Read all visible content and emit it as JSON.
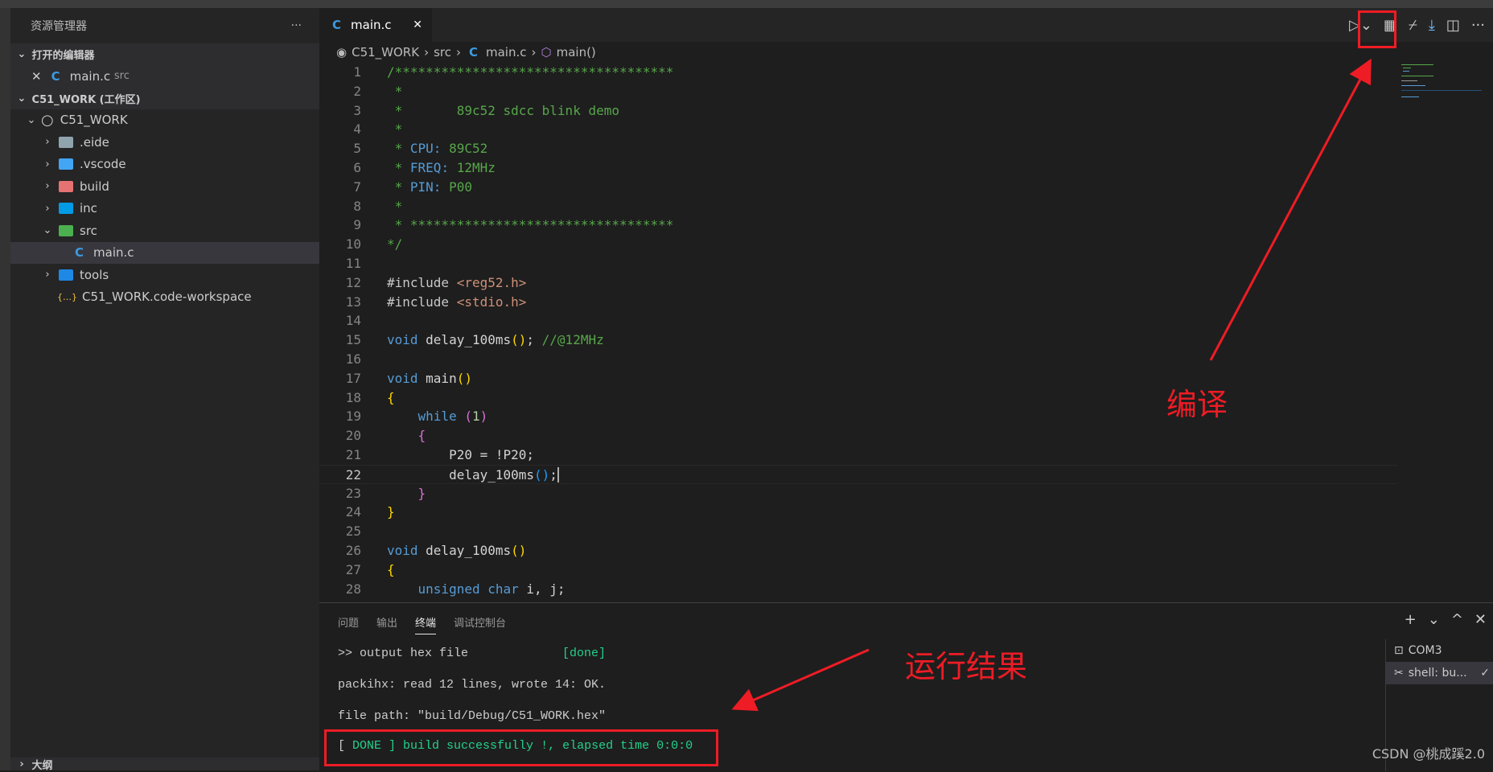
{
  "sidebar": {
    "title": "资源管理器",
    "more": "···",
    "open_editors": "打开的编辑器",
    "open_file": "main.c",
    "open_file_dir": "src",
    "workspace": "C51_WORK (工作区)",
    "tree": [
      {
        "label": "C51_WORK",
        "icon": "circle-icon",
        "chev": "⌄",
        "depth": 1
      },
      {
        "label": ".eide",
        "icon": "folder-icon",
        "color": "#90a4ae",
        "chev": "›",
        "depth": 2
      },
      {
        "label": ".vscode",
        "icon": "folder-vscode-icon",
        "color": "#42a5f5",
        "chev": "›",
        "depth": 2
      },
      {
        "label": "build",
        "icon": "folder-build-icon",
        "color": "#e57373",
        "chev": "›",
        "depth": 2
      },
      {
        "label": "inc",
        "icon": "folder-include-icon",
        "color": "#039be5",
        "chev": "›",
        "depth": 2
      },
      {
        "label": "src",
        "icon": "folder-src-icon",
        "color": "#4caf50",
        "chev": "⌄",
        "depth": 2
      },
      {
        "label": "main.c",
        "icon": "c-file-icon",
        "chev": "",
        "depth": 3,
        "selected": true
      },
      {
        "label": "tools",
        "icon": "folder-tools-icon",
        "color": "#1e88e5",
        "chev": "›",
        "depth": 2
      },
      {
        "label": "C51_WORK.code-workspace",
        "icon": "json-braces-icon",
        "chev": "",
        "depth": 2
      }
    ],
    "outline": "大纲"
  },
  "editor": {
    "tab": "main.c",
    "c_glyph": "C",
    "breadcrumb": [
      "C51_WORK",
      "src",
      "main.c",
      "main()"
    ],
    "current_line": 22,
    "lines": [
      [
        [
          "/************************************",
          "c"
        ]
      ],
      [
        [
          " *",
          "c"
        ]
      ],
      [
        [
          " *       89c52 sdcc blink demo",
          "c"
        ]
      ],
      [
        [
          " *",
          "c"
        ]
      ],
      [
        [
          " * ",
          "c"
        ],
        [
          "CPU:",
          "d"
        ],
        [
          " 89C52",
          "c"
        ]
      ],
      [
        [
          " * ",
          "c"
        ],
        [
          "FREQ:",
          "d"
        ],
        [
          " 12MHz",
          "c"
        ]
      ],
      [
        [
          " * ",
          "c"
        ],
        [
          "PIN:",
          "d"
        ],
        [
          " P00",
          "c"
        ]
      ],
      [
        [
          " *",
          "c"
        ]
      ],
      [
        [
          " * **********************************",
          "c"
        ]
      ],
      [
        [
          "*/",
          "c"
        ]
      ],
      [],
      [
        [
          "#include ",
          "p"
        ],
        [
          "<reg52.h>",
          "s"
        ]
      ],
      [
        [
          "#include ",
          "p"
        ],
        [
          "<stdio.h>",
          "s"
        ]
      ],
      [],
      [
        [
          "void",
          "k"
        ],
        [
          " delay_100ms",
          "t"
        ],
        [
          "()",
          "b1"
        ],
        [
          "; ",
          "t"
        ],
        [
          "//@12MHz",
          "c"
        ]
      ],
      [],
      [
        [
          "void",
          "k"
        ],
        [
          " main",
          "t"
        ],
        [
          "()",
          "b1"
        ]
      ],
      [
        [
          "{",
          "b1"
        ]
      ],
      [
        [
          "    ",
          "t"
        ],
        [
          "while",
          "k"
        ],
        [
          " ",
          "t"
        ],
        [
          "(",
          "b2"
        ],
        [
          "1",
          "n"
        ],
        [
          ")",
          "b2"
        ]
      ],
      [
        [
          "    ",
          "t"
        ],
        [
          "{",
          "b2"
        ]
      ],
      [
        [
          "        P20 = !P20;",
          "t"
        ]
      ],
      [
        [
          "        delay_100ms",
          "t"
        ],
        [
          "()",
          "b3"
        ],
        [
          ";",
          "t"
        ]
      ],
      [
        [
          "    ",
          "t"
        ],
        [
          "}",
          "b2"
        ]
      ],
      [
        [
          "}",
          "b1"
        ]
      ],
      [],
      [
        [
          "void",
          "k"
        ],
        [
          " delay_100ms",
          "t"
        ],
        [
          "()",
          "b1"
        ]
      ],
      [
        [
          "{",
          "b1"
        ]
      ],
      [
        [
          "    ",
          "t"
        ],
        [
          "unsigned",
          "k"
        ],
        [
          " ",
          "t"
        ],
        [
          "char",
          "k"
        ],
        [
          " i, j;",
          "t"
        ]
      ]
    ]
  },
  "panel": {
    "tabs": [
      "问题",
      "输出",
      "终端",
      "调试控制台"
    ],
    "active_tab": "终端",
    "terminal": [
      ">> output hex file             ",
      "[done]",
      "packihx: read 12 lines, wrote 14: OK.",
      "file path: \"build/Debug/C51_WORK.hex\"",
      "[ ",
      "DONE",
      " ] build successfully !, elapsed time 0:0:0"
    ],
    "terminals": [
      "COM3",
      "shell: bu..."
    ],
    "controls": [
      "+",
      "⌄",
      "^",
      "✕"
    ]
  },
  "annotations": {
    "compile": "编译",
    "result": "运行结果"
  },
  "watermark": "CSDN @桃成蹊2.0",
  "colors": {
    "annotation": "#ee1c25",
    "success": "#23d18b"
  }
}
